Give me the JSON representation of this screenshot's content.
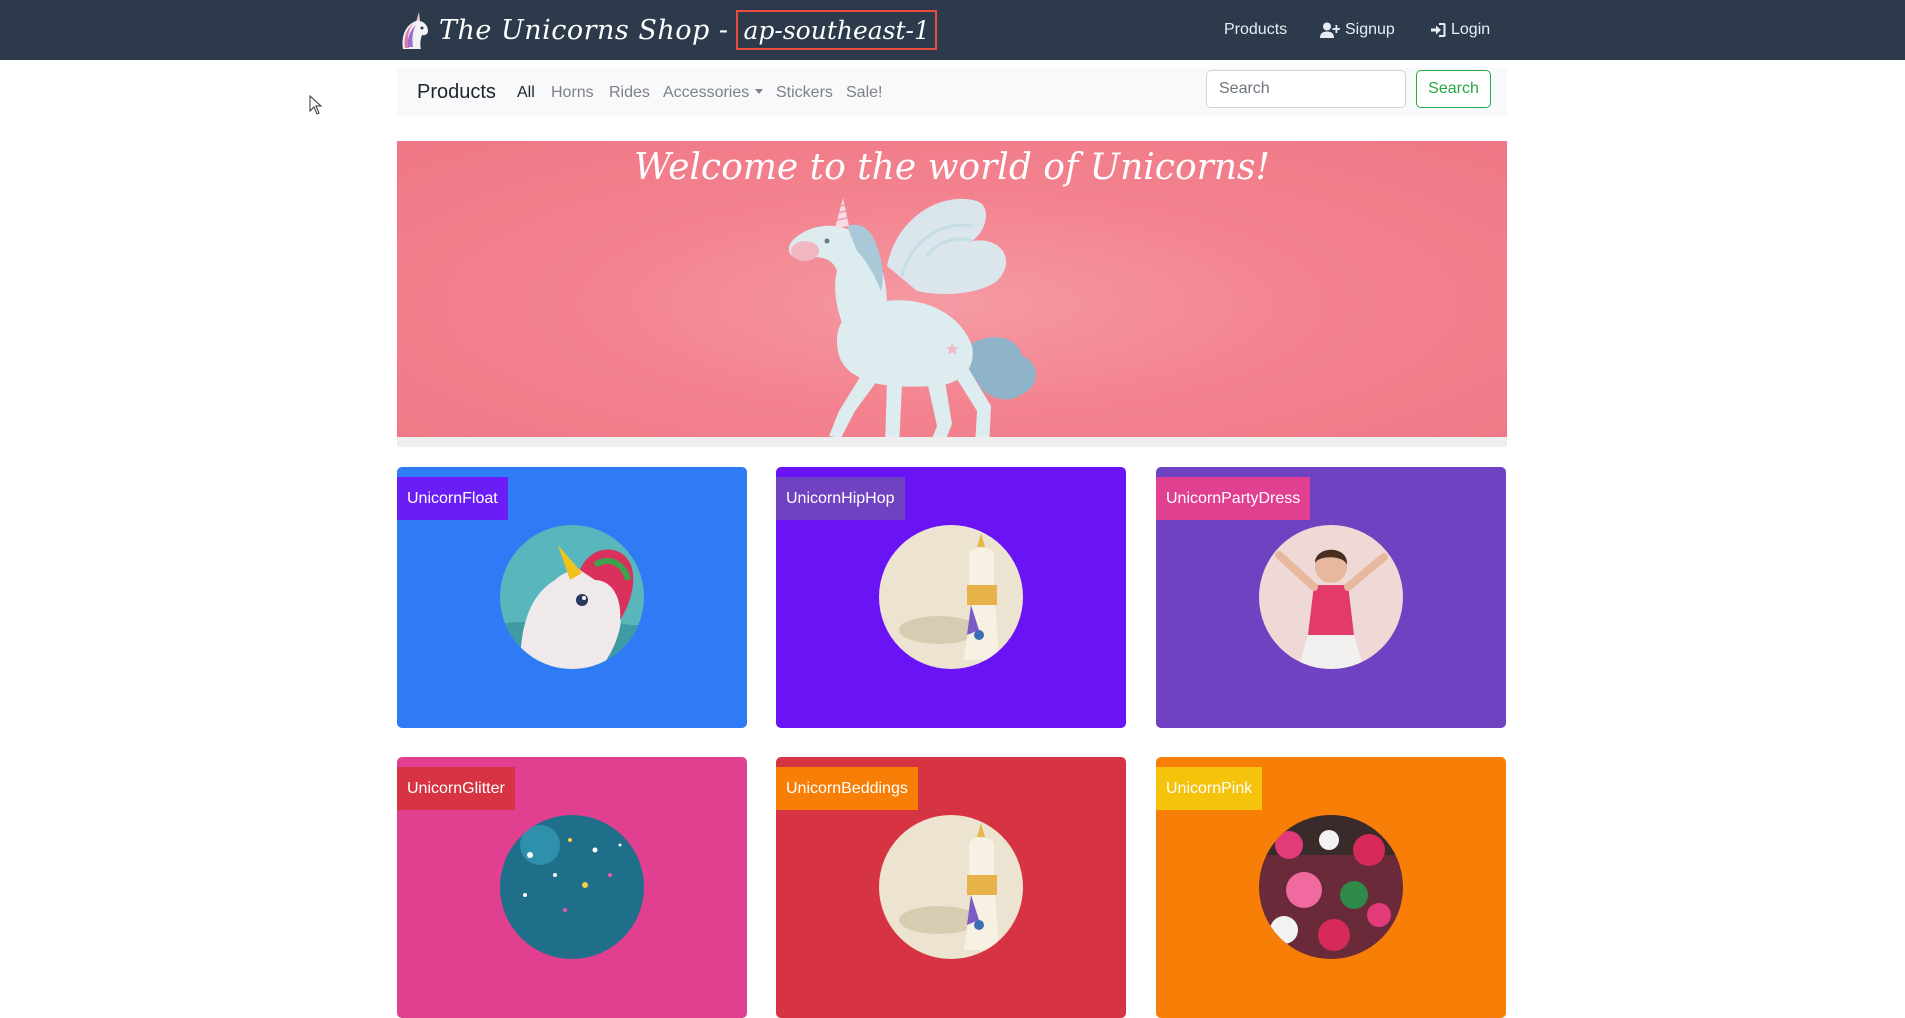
{
  "header": {
    "brand_title": "The Unicorns Shop -",
    "region": "ap-southeast-1",
    "nav": [
      {
        "label": "Products",
        "icon": ""
      },
      {
        "label": "Signup",
        "icon": "user-plus-icon"
      },
      {
        "label": "Login",
        "icon": "sign-in-icon"
      }
    ]
  },
  "subnav": {
    "title": "Products",
    "links": [
      "All",
      "Horns",
      "Rides",
      "Accessories",
      "Stickers",
      "Sale!"
    ],
    "active": "All",
    "search_placeholder": "Search",
    "search_button": "Search"
  },
  "hero": {
    "title": "Welcome to the world of Unicorns!"
  },
  "products": [
    {
      "name": "UnicornFloat",
      "color": "#2f7bf5",
      "label_color": "#6a1ef5",
      "image": "inflatable-unicorn"
    },
    {
      "name": "UnicornHipHop",
      "color": "#6a14f5",
      "label_color": "#6f42c1",
      "image": "toy-unicorn"
    },
    {
      "name": "UnicornPartyDress",
      "color": "#6f42c1",
      "label_color": "#e0408f",
      "image": "girl-in-dress"
    },
    {
      "name": "UnicornGlitter",
      "color": "#e0408f",
      "label_color": "#d63442",
      "image": "glitter"
    },
    {
      "name": "UnicornBeddings",
      "color": "#d63442",
      "label_color": "#f77f08",
      "image": "toy-unicorn"
    },
    {
      "name": "UnicornPink",
      "color": "#f77f08",
      "label_color": "#f5c20c",
      "image": "pink-market"
    }
  ]
}
